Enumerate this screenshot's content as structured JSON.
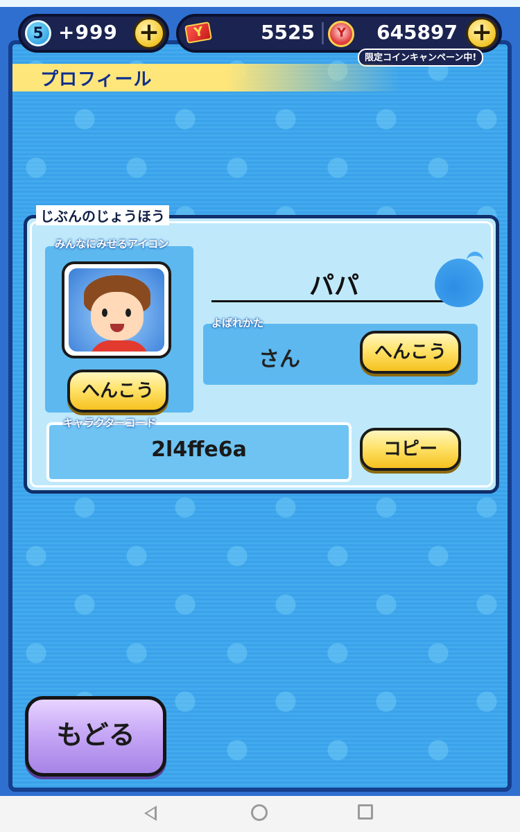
{
  "header": {
    "level": "5",
    "stamina": "+999",
    "plus_symbol": "+",
    "ticket_count": "5525",
    "ymoney_count": "645897",
    "campaign_text": "限定コインキャンペーン中!"
  },
  "page": {
    "title": "プロフィール"
  },
  "profile": {
    "section_label": "じぶんのじょうほう",
    "icon_label": "みんなにみせるアイコン",
    "icon_change_label": "へんこう",
    "name": "パパ",
    "suffix_label": "よばれかた",
    "suffix_value": "さん",
    "suffix_change_label": "へんこう",
    "code_label": "キャラクターコード",
    "code_value": "2l4ffe6a",
    "copy_label": "コピー"
  },
  "footer": {
    "back_label": "もどる"
  },
  "colors": {
    "background": "#3aa2ea",
    "panel": "#bfe9fb",
    "button_yellow": "#ffe36b",
    "button_purple": "#c7a8f6",
    "title_banner": "#ffe67a"
  }
}
